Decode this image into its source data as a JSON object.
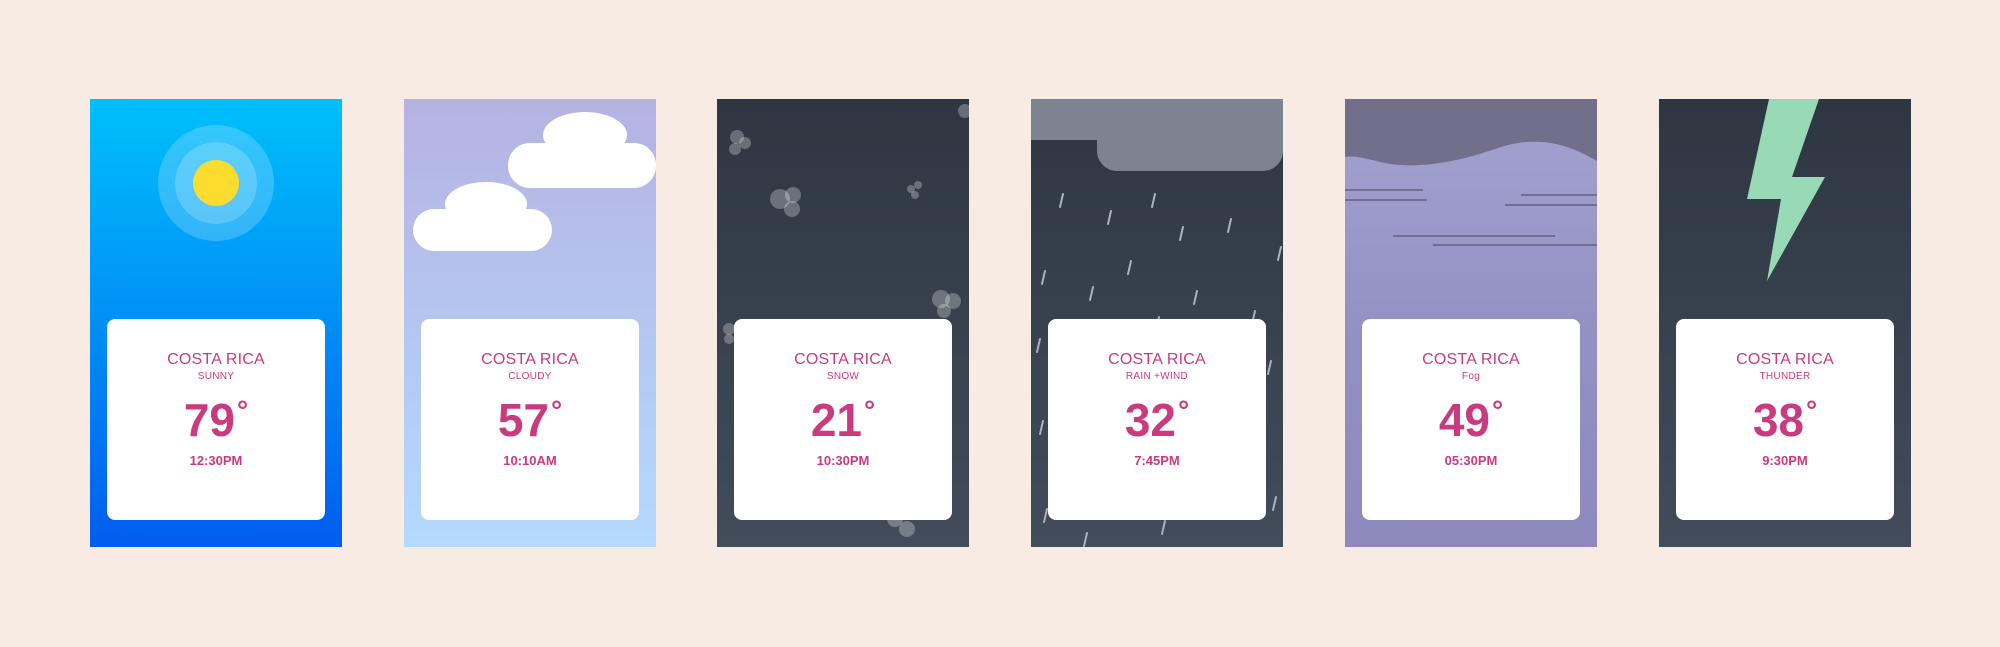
{
  "cards": [
    {
      "city": "COSTA RICA",
      "condition": "SUNNY",
      "temp": "79",
      "degree": "°",
      "time": "12:30PM",
      "icon": "sun-icon"
    },
    {
      "city": "COSTA RICA",
      "condition": "CLOUDY",
      "temp": "57",
      "degree": "°",
      "time": "10:10AM",
      "icon": "cloud-icon"
    },
    {
      "city": "COSTA RICA",
      "condition": "SNOW",
      "temp": "21",
      "degree": "°",
      "time": "10:30PM",
      "icon": "snowflake-icon"
    },
    {
      "city": "COSTA RICA",
      "condition": "RAIN +WIND",
      "temp": "32",
      "degree": "°",
      "time": "7:45PM",
      "icon": "rain-icon"
    },
    {
      "city": "COSTA RICA",
      "condition": "Fog",
      "temp": "49",
      "degree": "°",
      "time": "05:30PM",
      "icon": "fog-icon"
    },
    {
      "city": "COSTA RICA",
      "condition": "THUNDER",
      "temp": "38",
      "degree": "°",
      "time": "9:30PM",
      "icon": "lightning-icon"
    }
  ],
  "colors": {
    "page_background": "#f7ebe4",
    "accent_text": "#c93a7f",
    "sunny_top": "#00c0fb",
    "sunny_bottom": "#015df0",
    "sun": "#fbdc2f",
    "cloudy_top": "#b5b2e2",
    "cloudy_bottom": "#b4dafd",
    "dark_top": "#2e3642",
    "dark_bottom": "#424c5a",
    "rain_cloud": "#7b8490",
    "fog_band": "#716f8a",
    "fog_body": "#9a98c8",
    "thunder_bolt": "#98d9b6"
  }
}
